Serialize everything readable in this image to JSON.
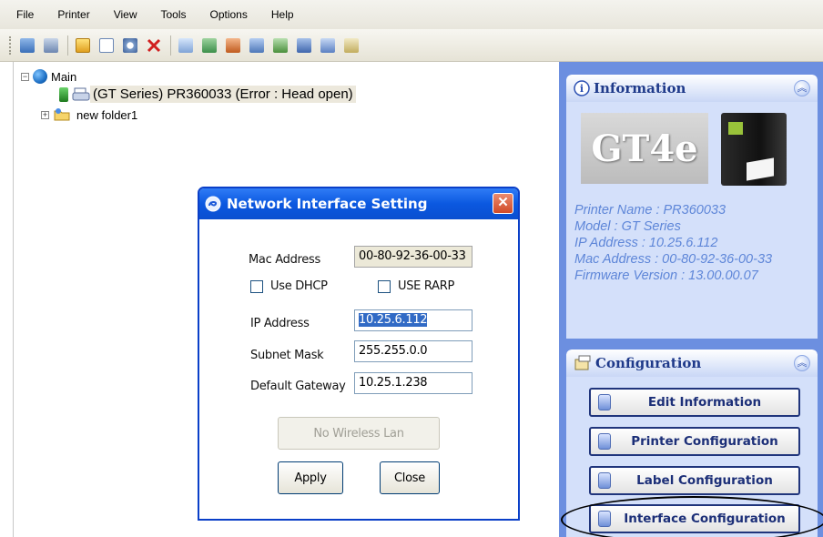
{
  "menu": [
    "File",
    "Printer",
    "View",
    "Tools",
    "Options",
    "Help"
  ],
  "toolbar": {
    "icons": [
      "add-printer-icon",
      "printer-list-icon",
      "properties-icon",
      "document-icon",
      "search-printer-icon",
      "delete-icon",
      "copy-icon",
      "monitor-icon",
      "refresh-icon",
      "image-icon",
      "settings-icon",
      "network-icon",
      "save-icon",
      "export-icon"
    ]
  },
  "tree": {
    "root_label": "Main",
    "printer_label": "(GT Series) PR360033 (Error : Head open)",
    "folder_label": "new folder1"
  },
  "information": {
    "title": "Information",
    "logo_text": "GT4e",
    "lines": [
      "Printer Name : PR360033",
      "Model : GT Series",
      "IP Address : 10.25.6.112",
      "Mac Address : 00-80-92-36-00-33",
      "Firmware Version : 13.00.00.07"
    ]
  },
  "configuration": {
    "title": "Configuration",
    "buttons": [
      "Edit Information",
      "Printer Configuration",
      "Label Configuration",
      "Interface Configuration"
    ]
  },
  "dialog": {
    "title": "Network Interface Setting",
    "mac_label": "Mac Address",
    "mac_value": "00-80-92-36-00-33",
    "dhcp_label": "Use DHCP",
    "rarp_label": "USE RARP",
    "ip_label": "IP Address",
    "ip_value": "10.25.6.112",
    "subnet_label": "Subnet Mask",
    "subnet_value": "255.255.0.0",
    "gateway_label": "Default Gateway",
    "gateway_value": "10.25.1.238",
    "wireless_label": "No Wireless Lan",
    "apply_label": "Apply",
    "close_label": "Close"
  },
  "colors": {
    "panel_bg": "#6c8fe0",
    "card_body": "#d4e0fa",
    "info_text": "#5e86d8",
    "titlebar": "#0b58e0"
  }
}
